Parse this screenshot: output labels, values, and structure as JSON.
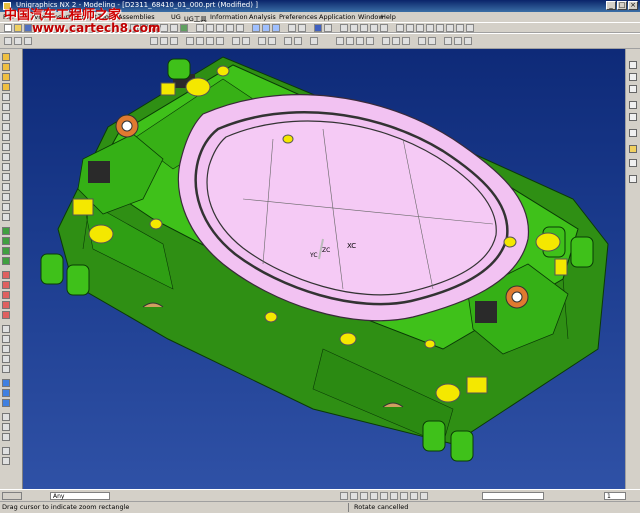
{
  "window": {
    "title": "Unigraphics NX 2 - Modeling - [D2311_68410_01_000.prt (Modified) ]"
  },
  "watermark": {
    "cn": "中国汽车工程师之家",
    "url": "www.cartech8.com"
  },
  "menu": [
    "File",
    "Edit",
    "View",
    "Insert",
    "Format",
    "Tools",
    "Assemblies",
    "UG",
    "UG工具",
    "Information",
    "Analysis",
    "Preferences",
    "Application",
    "Window",
    "Help"
  ],
  "bottom": {
    "filter_value": "Any",
    "layer_value": "1"
  },
  "viewport": {
    "label_xc": "XC",
    "label_yc": "YC",
    "label_zc": "ZC",
    "colors": {
      "base": "#3fc11a",
      "panel": "#f2c2f2",
      "bg_top": "#0e2a78",
      "bg_bottom": "#2f51a6"
    }
  },
  "status": {
    "prompt": "Drag cursor to indicate zoom rectangle",
    "message": "Rotate cancelled"
  }
}
